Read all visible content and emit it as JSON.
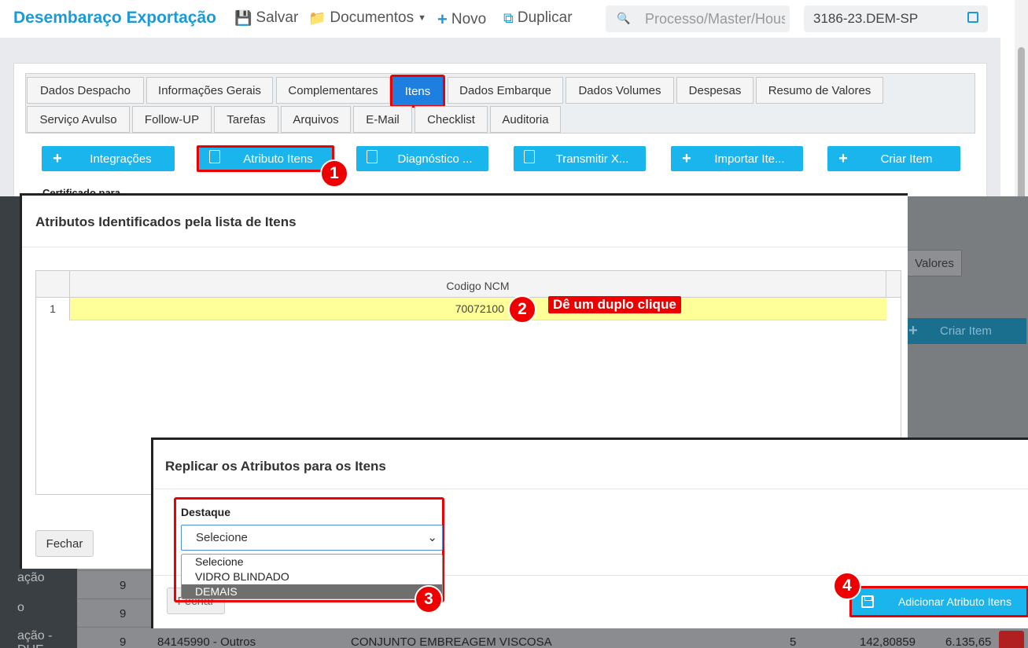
{
  "app": {
    "title": "Desembaraço Exportação",
    "actions": {
      "save": "Salvar",
      "documents": "Documentos",
      "new": "Novo",
      "duplicate": "Duplicar"
    },
    "search_placeholder": "Processo/Master/House",
    "process_code": "3186-23.DEM-SP"
  },
  "tabs_row1": [
    "Dados Despacho",
    "Informações Gerais",
    "Complementares",
    "Itens",
    "Dados Embarque",
    "Dados Volumes",
    "Despesas",
    "Resumo de Valores"
  ],
  "tabs_row2": [
    "Serviço Avulso",
    "Follow-UP",
    "Tarefas",
    "Arquivos",
    "E-Mail",
    "Checklist",
    "Auditoria"
  ],
  "active_tab": "Itens",
  "buttons": {
    "integracoes": "Integrações",
    "atributo_itens": "Atributo Itens",
    "diagnostico": "Diagnóstico ...",
    "transmitir": "Transmitir X...",
    "importar": "Importar Ite...",
    "criar_item": "Criar Item"
  },
  "certificado_label": "Certificado para",
  "background": {
    "resumo_tab": "Valores",
    "criar_item": "Criar Item",
    "sidebar": [
      "ação",
      "o",
      "ação - DUE"
    ],
    "rows": [
      {
        "num": "9",
        "code": "",
        "desc": "",
        "qty": "",
        "unit": "",
        "total": ""
      },
      {
        "num": "9",
        "code": "",
        "desc": "",
        "qty": "",
        "unit": "",
        "total": ""
      },
      {
        "num": "9",
        "code": "84145990 - Outros",
        "desc": "CONJUNTO EMBREAGEM VISCOSA",
        "qty": "5",
        "unit": "142,80859",
        "total": "6.135,65"
      }
    ]
  },
  "modal_atributos": {
    "title": "Atributos Identificados pela lista de Itens",
    "column": "Codigo NCM",
    "rows": [
      {
        "num": "1",
        "ncm": "70072100"
      }
    ],
    "close": "Fechar"
  },
  "hint_text": "Dê um duplo clique",
  "badges": [
    "1",
    "2",
    "3",
    "4"
  ],
  "modal_replicar": {
    "title": "Replicar os Atributos para os Itens",
    "field_label": "Destaque",
    "selected": "Selecione",
    "options": [
      "Selecione",
      "VIDRO BLINDADO",
      "DEMAIS"
    ],
    "highlighted_option": "DEMAIS",
    "close": "Fechar",
    "submit": "Adicionar Atributo Itens"
  },
  "colors": {
    "accent": "#1a9ad6",
    "button": "#1ab5ec",
    "highlight": "#e00000",
    "active_tab": "#1e7fe0"
  }
}
